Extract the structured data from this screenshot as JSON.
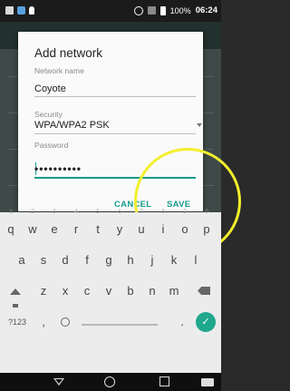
{
  "status_bar": {
    "battery": "100%",
    "time": "06:24",
    "icons": [
      "image-icon",
      "app-icon",
      "location-icon",
      "vibrate-icon",
      "no-sim-icon",
      "battery-icon"
    ]
  },
  "dialog": {
    "title": "Add network",
    "network_name_label": "Network name",
    "network_name_value": "Coyote",
    "security_label": "Security",
    "security_value": "WPA/WPA2 PSK",
    "password_label": "Password",
    "password_value": "••••••••••",
    "cancel_label": "CANCEL",
    "save_label": "SAVE"
  },
  "keyboard": {
    "row1": [
      {
        "key": "q",
        "hint": "1"
      },
      {
        "key": "w",
        "hint": "2"
      },
      {
        "key": "e",
        "hint": "3"
      },
      {
        "key": "r",
        "hint": "4"
      },
      {
        "key": "t",
        "hint": "5"
      },
      {
        "key": "y",
        "hint": "6"
      },
      {
        "key": "u",
        "hint": "7"
      },
      {
        "key": "i",
        "hint": "8"
      },
      {
        "key": "o",
        "hint": "9"
      },
      {
        "key": "p",
        "hint": "0"
      }
    ],
    "row2": [
      "a",
      "s",
      "d",
      "f",
      "g",
      "h",
      "j",
      "k",
      "l"
    ],
    "row3": [
      "z",
      "x",
      "c",
      "v",
      "b",
      "n",
      "m"
    ],
    "symbols_label": "?123",
    "comma": ",",
    "period": ".",
    "enter_icon": "check-icon"
  },
  "nav_bar": {
    "icons": [
      "back-icon",
      "home-icon",
      "recents-icon",
      "keyboard-switch-icon"
    ]
  },
  "colors": {
    "accent": "#179c8a",
    "annotation": "#f3ef2c"
  }
}
